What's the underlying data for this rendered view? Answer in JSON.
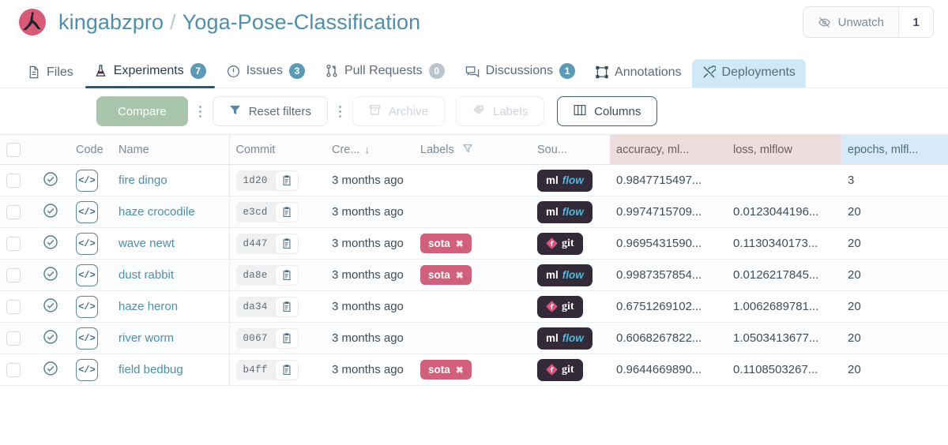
{
  "header": {
    "owner": "kingabzpro",
    "separator": "/",
    "repo": "Yoga-Pose-Classification",
    "avatar_icon": "yoga-pose-avatar",
    "watch_label": "Unwatch",
    "watch_icon": "eye-slash-icon",
    "watch_count": "1"
  },
  "nav": {
    "tabs": [
      {
        "label": "Files",
        "icon": "file-icon",
        "badge": null,
        "active": false,
        "hovered": false
      },
      {
        "label": "Experiments",
        "icon": "flask-icon",
        "badge": "7",
        "active": true,
        "hovered": false
      },
      {
        "label": "Issues",
        "icon": "alert-circle-icon",
        "badge": "3",
        "active": false,
        "hovered": false
      },
      {
        "label": "Pull Requests",
        "icon": "pull-request-icon",
        "badge": "0",
        "active": false,
        "hovered": false
      },
      {
        "label": "Discussions",
        "icon": "comments-icon",
        "badge": "1",
        "active": false,
        "hovered": false
      },
      {
        "label": "Annotations",
        "icon": "bounding-box-icon",
        "badge": null,
        "active": false,
        "hovered": false
      },
      {
        "label": "Deployments",
        "icon": "tools-icon",
        "badge": null,
        "active": false,
        "hovered": true
      }
    ]
  },
  "toolbar": {
    "compare_label": "Compare",
    "reset_filters_label": "Reset filters",
    "reset_filters_icon": "funnel-icon",
    "archive_label": "Archive",
    "archive_icon": "archive-icon",
    "labels_label": "Labels",
    "labels_icon": "tag-icon",
    "columns_label": "Columns",
    "columns_icon": "columns-icon",
    "overflow_icon": "vertical-dots-icon"
  },
  "table": {
    "headers": {
      "select": "",
      "status": "",
      "code": "Code",
      "name": "Name",
      "commit": "Commit",
      "created": "Cre...",
      "created_sort": "↓",
      "labels": "Labels",
      "labels_filter_icon": "funnel-icon",
      "source": "Sou...",
      "accuracy": "accuracy, ml...",
      "loss": "loss, mlflow",
      "epochs": "epochs, mlfl..."
    },
    "rows": [
      {
        "status_icon": "check-circle-icon",
        "code_icon": "code-icon",
        "name": "fire dingo",
        "commit": "1d20",
        "created": "3 months ago",
        "labels": [],
        "source": "mlflow",
        "accuracy": "0.9847715497...",
        "loss": "",
        "epochs": "3"
      },
      {
        "status_icon": "check-circle-icon",
        "code_icon": "code-icon",
        "name": "haze crocodile",
        "commit": "e3cd",
        "created": "3 months ago",
        "labels": [],
        "source": "mlflow",
        "accuracy": "0.9974715709...",
        "loss": "0.0123044196...",
        "epochs": "20"
      },
      {
        "status_icon": "check-circle-icon",
        "code_icon": "code-icon",
        "name": "wave newt",
        "commit": "d447",
        "created": "3 months ago",
        "labels": [
          "sota"
        ],
        "source": "git",
        "accuracy": "0.9695431590...",
        "loss": "0.1130340173...",
        "epochs": "20"
      },
      {
        "status_icon": "check-circle-icon",
        "code_icon": "code-icon",
        "name": "dust rabbit",
        "commit": "da8e",
        "created": "3 months ago",
        "labels": [
          "sota"
        ],
        "source": "mlflow",
        "accuracy": "0.9987357854...",
        "loss": "0.0126217845...",
        "epochs": "20"
      },
      {
        "status_icon": "check-circle-icon",
        "code_icon": "code-icon",
        "name": "haze heron",
        "commit": "da34",
        "created": "3 months ago",
        "labels": [],
        "source": "git",
        "accuracy": "0.6751269102...",
        "loss": "1.0062689781...",
        "epochs": "20"
      },
      {
        "status_icon": "check-circle-icon",
        "code_icon": "code-icon",
        "name": "river worm",
        "commit": "0067",
        "created": "3 months ago",
        "labels": [],
        "source": "mlflow",
        "accuracy": "0.6068267822...",
        "loss": "1.0503413677...",
        "epochs": "20"
      },
      {
        "status_icon": "check-circle-icon",
        "code_icon": "code-icon",
        "name": "field bedbug",
        "commit": "b4ff",
        "created": "3 months ago",
        "labels": [
          "sota"
        ],
        "source": "git",
        "accuracy": "0.9644669890...",
        "loss": "0.1108503267...",
        "epochs": "20"
      }
    ]
  },
  "colors": {
    "link": "#4d8fad",
    "accent_teal": "#1f5d77",
    "tag_pink": "#d1607c",
    "compare_green": "#a8c4ac",
    "metric_group_bg": "#eddddd",
    "epoch_group_bg": "#d6ebf7",
    "avatar_pink": "#d95a77"
  }
}
